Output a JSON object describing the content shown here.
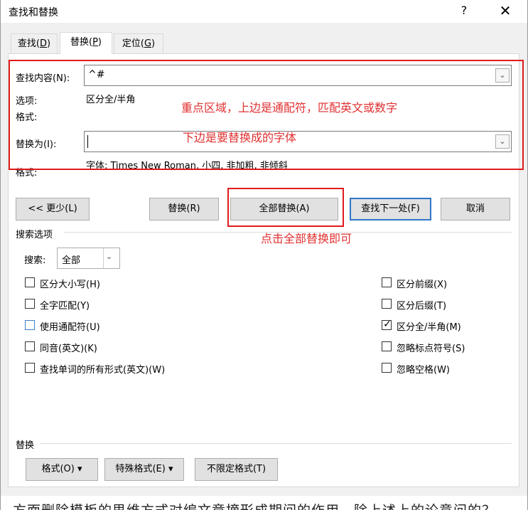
{
  "window": {
    "title": "查找和替换",
    "help_label": "?",
    "close_label": "✕"
  },
  "tabs": [
    {
      "label": "查找(",
      "key": "D",
      "suffix": ")"
    },
    {
      "label": "替换(",
      "key": "P",
      "suffix": ")"
    },
    {
      "label": "定位(",
      "key": "G",
      "suffix": ")"
    }
  ],
  "find": {
    "label": "查找内容(N):",
    "value": "^#",
    "options_label": "选项:",
    "options_value": "区分全/半角",
    "format_label": "格式:"
  },
  "replace": {
    "label": "替换为(I):",
    "value": "",
    "format_label": "格式:",
    "format_value": "字体: Times New Roman, 小四, 非加粗, 非倾斜"
  },
  "annotations": {
    "note1": "重点区域，上边是通配符，匹配英文或数字",
    "note2": "下边是要替换成的字体",
    "note3": "点击全部替换即可"
  },
  "buttons": {
    "less": "<< 更少(L)",
    "replace": "替换(R)",
    "replace_all": "全部替换(A)",
    "find_next": "查找下一处(F)",
    "cancel": "取消"
  },
  "search_options": {
    "group_label": "搜索选项",
    "search_label": "搜索:",
    "search_value": "全部",
    "left_options": [
      {
        "label": "区分大小写(H)",
        "checked": false
      },
      {
        "label": "全字匹配(Y)",
        "checked": false
      },
      {
        "label": "使用通配符(U)",
        "checked": false
      },
      {
        "label": "同音(英文)(K)",
        "checked": false
      },
      {
        "label": "查找单词的所有形式(英文)(W)",
        "checked": false
      }
    ],
    "right_options": [
      {
        "label": "区分前缀(X)",
        "checked": false
      },
      {
        "label": "区分后缀(T)",
        "checked": false
      },
      {
        "label": "区分全/半角(M)",
        "checked": true
      },
      {
        "label": "忽略标点符号(S)",
        "checked": false
      },
      {
        "label": "忽略空格(W)",
        "checked": false
      }
    ]
  },
  "replace_group": {
    "label": "替换",
    "format_btn": "格式(O) ▾",
    "special_btn": "特殊格式(E) ▾",
    "no_format_btn": "不限定格式(T)"
  },
  "background_text": "方面删除模板的思维方式对编文章摘形成期间的作用，除上述上的论意问的？"
}
